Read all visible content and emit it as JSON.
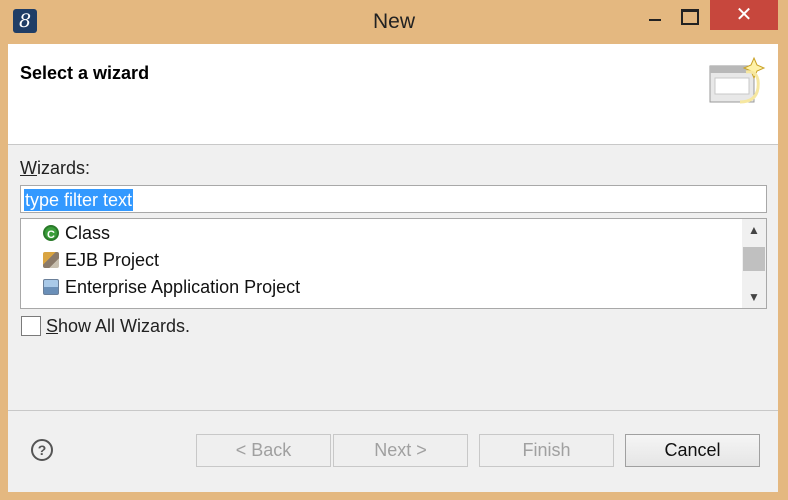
{
  "window": {
    "title": "New",
    "app_icon_glyph": "8",
    "close_glyph": "✕"
  },
  "banner": {
    "title": "Select a wizard",
    "icon": "wizard-banner-icon"
  },
  "wizards": {
    "label_mnemonic": "W",
    "label_rest": "izards:",
    "filter_value": "type filter text",
    "items": [
      {
        "label": "Class",
        "icon": "java-class-icon"
      },
      {
        "label": "EJB Project",
        "icon": "ejb-project-icon"
      },
      {
        "label": "Enterprise Application Project",
        "icon": "enterprise-app-icon"
      }
    ]
  },
  "show_all": {
    "mnemonic": "S",
    "rest": "how All Wizards.",
    "checked": false
  },
  "buttons": {
    "help_glyph": "?",
    "back": "< Back",
    "next": "Next >",
    "finish": "Finish",
    "cancel": "Cancel"
  }
}
